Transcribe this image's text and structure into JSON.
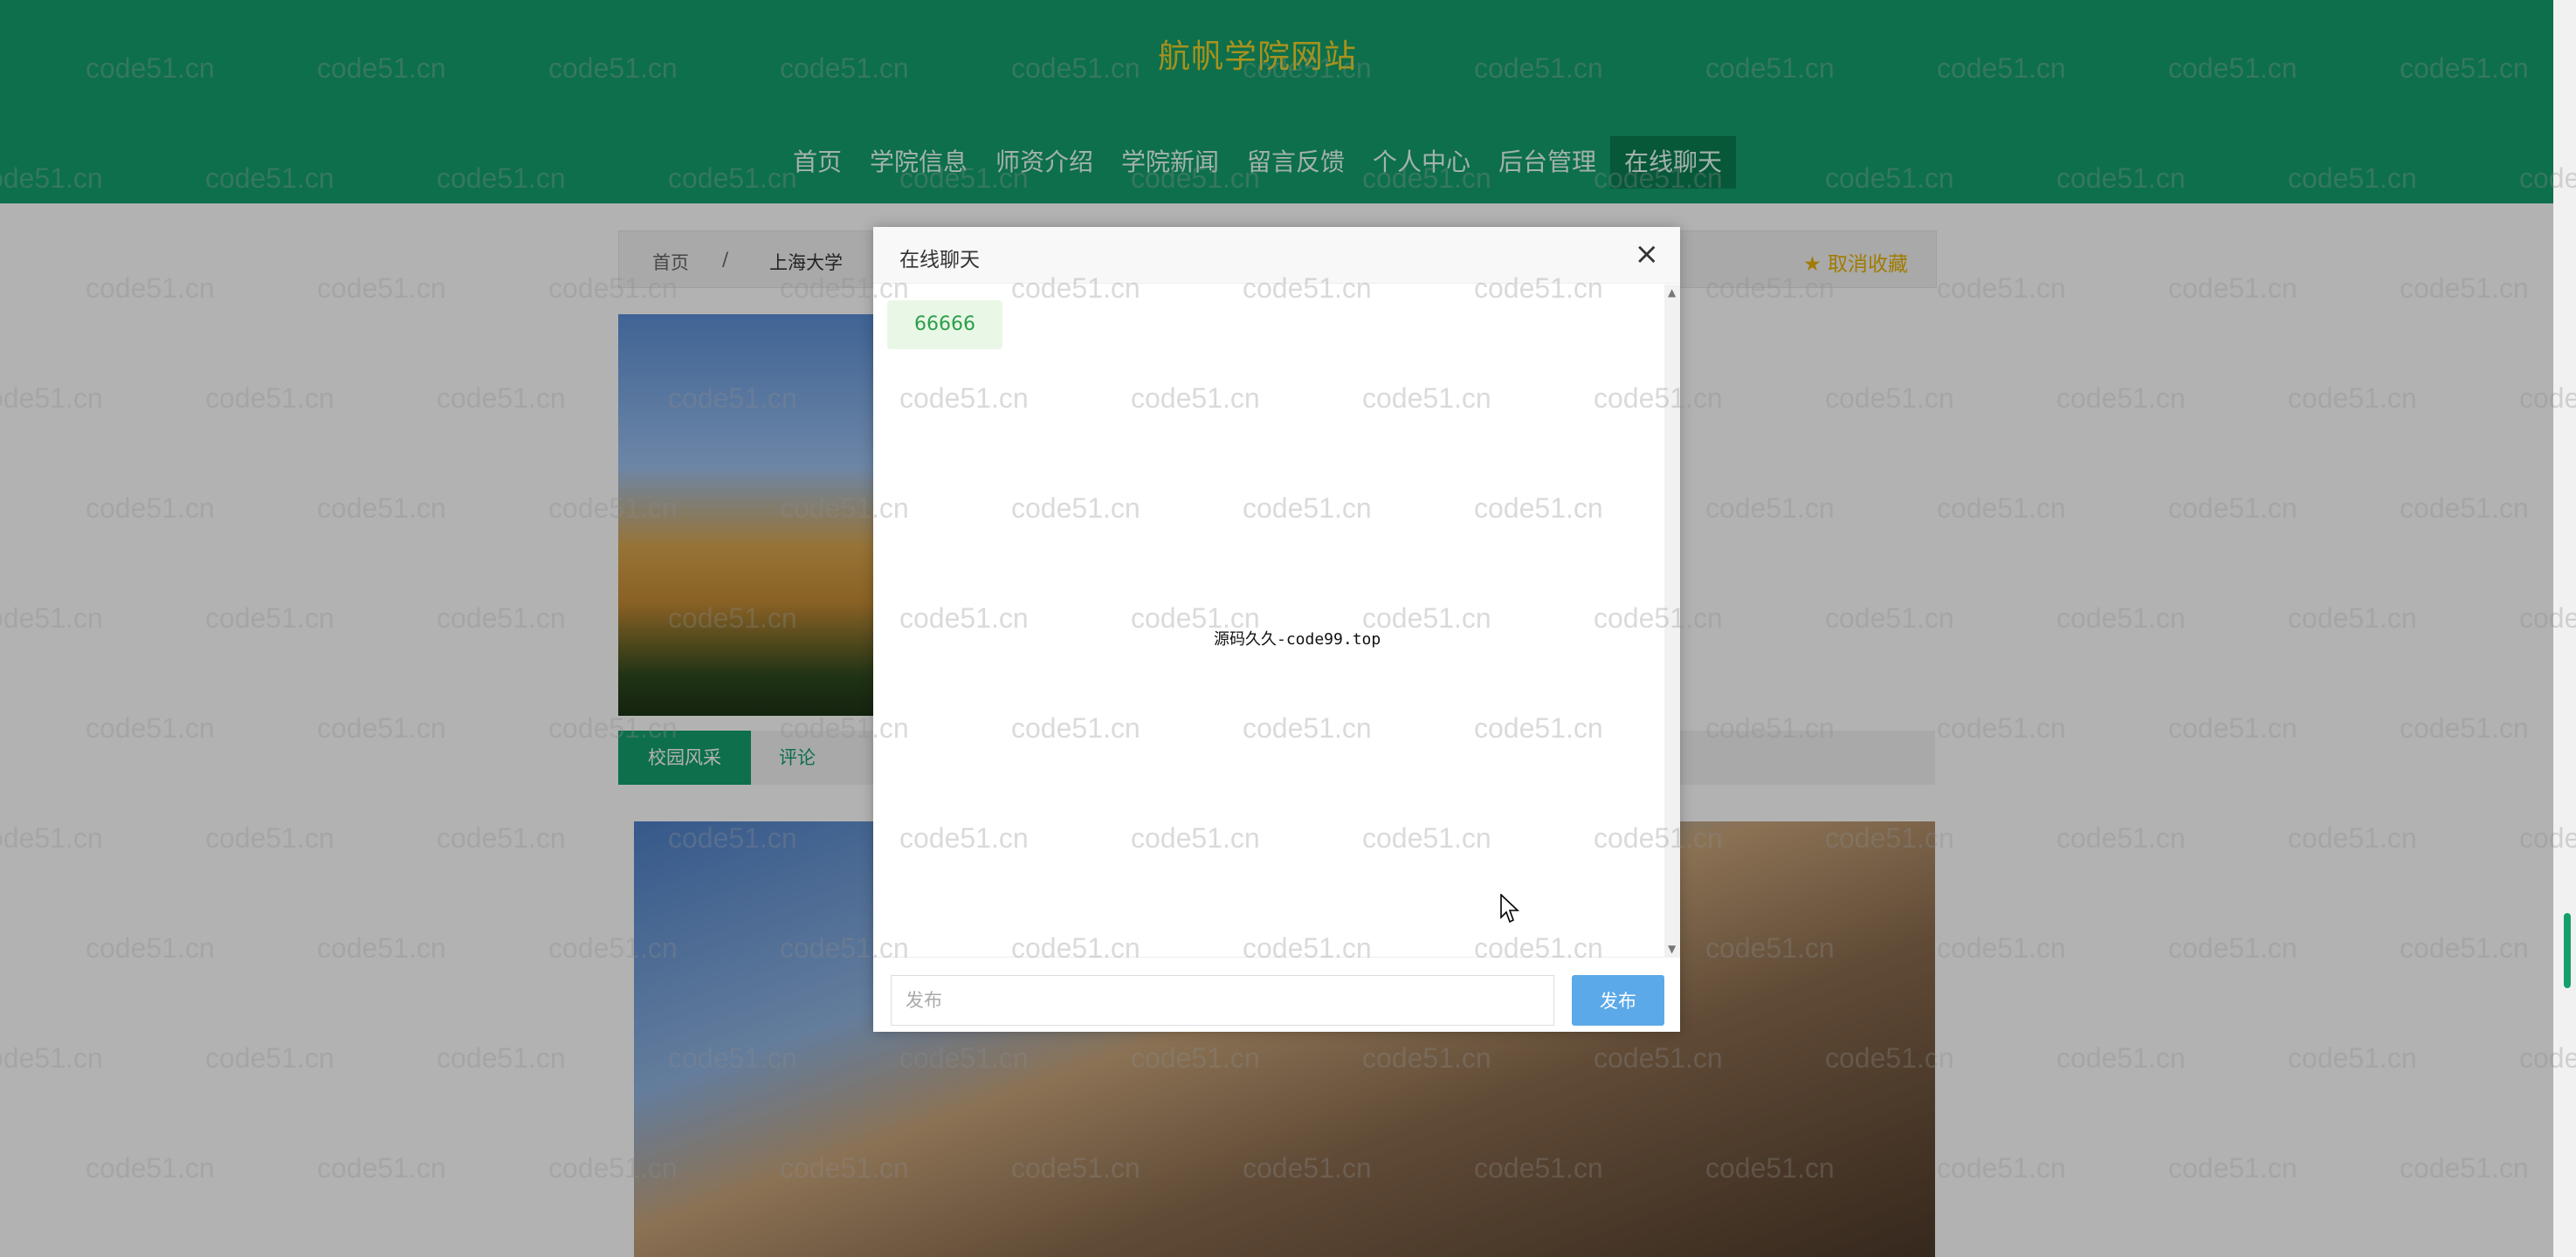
{
  "header": {
    "site_title": "航帆学院网站",
    "nav": [
      "首页",
      "学院信息",
      "师资介绍",
      "学院新闻",
      "留言反馈",
      "个人中心",
      "后台管理",
      "在线聊天"
    ],
    "active_nav": "在线聊天"
  },
  "breadcrumb": {
    "home": "首页",
    "separator": "/",
    "current": "上海大学",
    "favorite": "★ 取消收藏"
  },
  "tabs": [
    "校园风采",
    "评论"
  ],
  "dialog": {
    "title": "在线聊天",
    "close": "×",
    "messages": [
      "66666"
    ],
    "center_text": "源码久久-code99.top",
    "input_placeholder": "发布",
    "send_label": "发布"
  },
  "watermark": "code51.cn",
  "colors": {
    "primary": "#13a06c",
    "title": "#f0d02a",
    "send_button": "#5ba9e8"
  }
}
